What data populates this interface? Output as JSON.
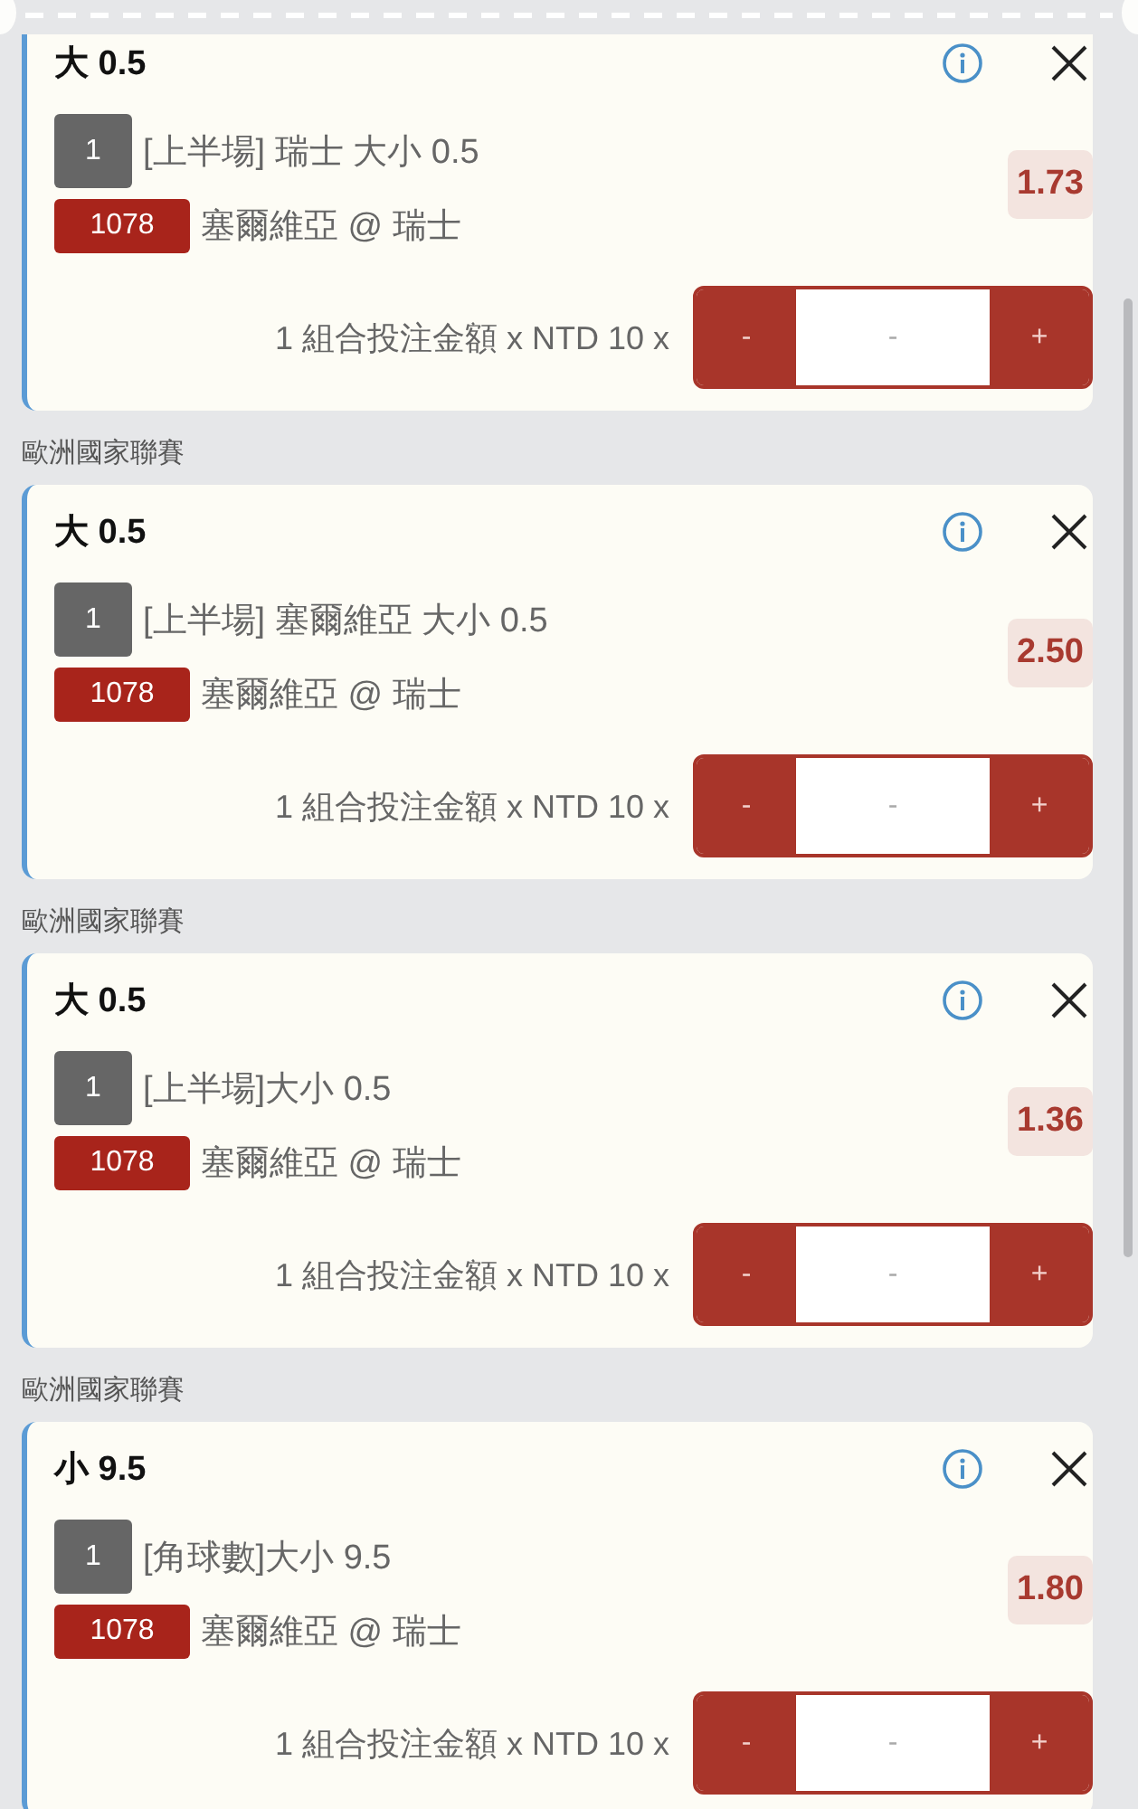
{
  "bets": [
    {
      "title": "大 0.5",
      "leg": "1",
      "market": "[上半場] 瑞士 大小 0.5",
      "match_id": "1078",
      "match": "塞爾維亞 @ 瑞士",
      "odds": "1.73",
      "stake_label": "1 組合投注金額 x NTD 10 x",
      "stepper": {
        "minus": "-",
        "placeholder": "-",
        "plus": "+"
      }
    },
    {
      "league": "歐洲國家聯賽",
      "title": "大 0.5",
      "leg": "1",
      "market": "[上半場] 塞爾維亞 大小 0.5",
      "match_id": "1078",
      "match": "塞爾維亞 @ 瑞士",
      "odds": "2.50",
      "stake_label": "1 組合投注金額 x NTD 10 x",
      "stepper": {
        "minus": "-",
        "placeholder": "-",
        "plus": "+"
      }
    },
    {
      "league": "歐洲國家聯賽",
      "title": "大 0.5",
      "leg": "1",
      "market": "[上半場]大小 0.5",
      "match_id": "1078",
      "match": "塞爾維亞 @ 瑞士",
      "odds": "1.36",
      "stake_label": "1 組合投注金額 x NTD 10 x",
      "stepper": {
        "minus": "-",
        "placeholder": "-",
        "plus": "+"
      }
    },
    {
      "league": "歐洲國家聯賽",
      "title": "小 9.5",
      "leg": "1",
      "market": "[角球數]大小 9.5",
      "match_id": "1078",
      "match": "塞爾維亞 @ 瑞士",
      "odds": "1.80",
      "stake_label": "1 組合投注金額 x NTD 10 x",
      "stepper": {
        "minus": "-",
        "placeholder": "-",
        "plus": "+"
      }
    }
  ]
}
